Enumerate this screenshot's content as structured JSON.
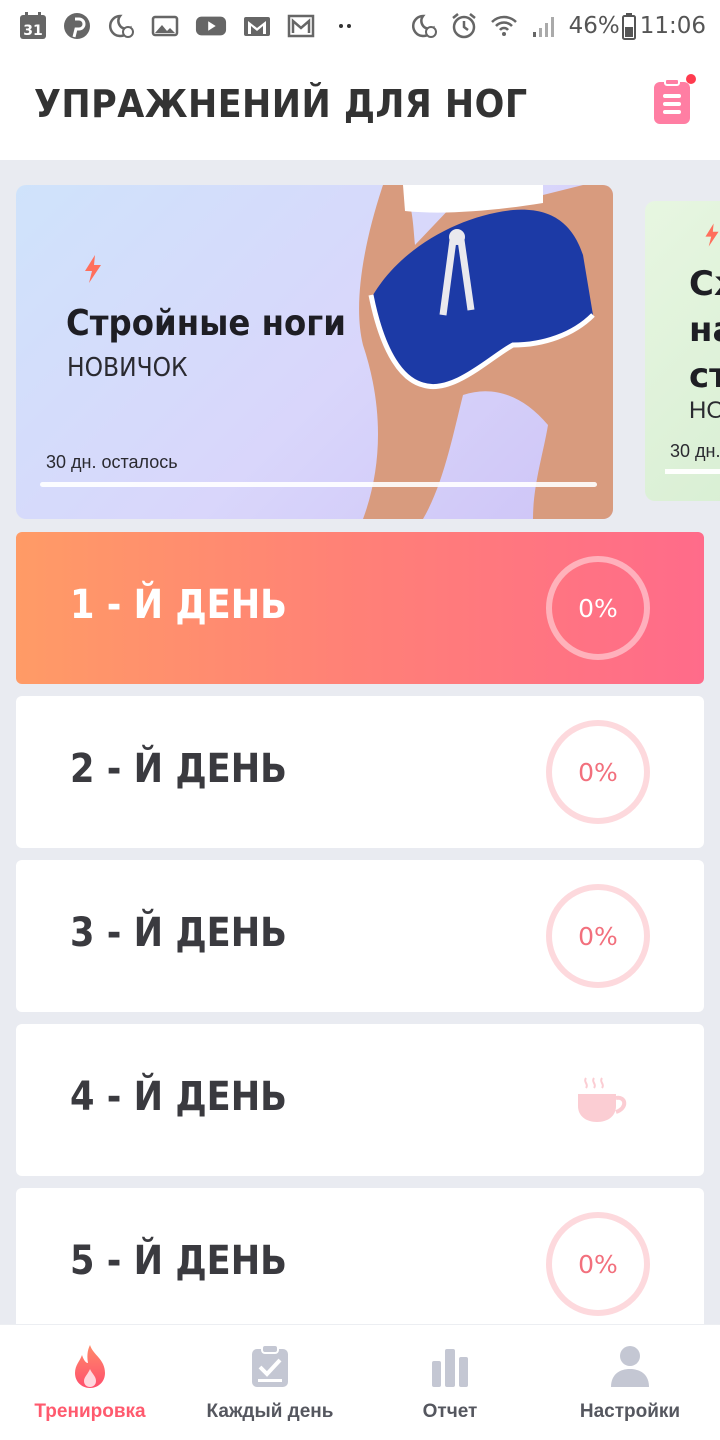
{
  "status_bar": {
    "calendar_day": "31",
    "battery": "46%",
    "time": "11:06",
    "icons": [
      "calendar-icon",
      "pinterest-icon",
      "moon-alarm-icon",
      "image-icon",
      "youtube-icon",
      "gmail-icon",
      "gmail-outline-icon",
      "dots-icon",
      "moon-alarm-icon",
      "alarm-icon",
      "wifi-icon",
      "signal-icon",
      "battery-icon"
    ]
  },
  "header": {
    "title": "УПРАЖНЕНИЙ ДЛЯ НОГ",
    "notes_icon": "clipboard-icon",
    "has_notification_dot": true
  },
  "plans": [
    {
      "name": "Стройные ноги",
      "level": "НОВИЧОК",
      "remaining": "30 дн. осталось",
      "progress": 0,
      "icon": "lightning-icon",
      "accent": "#ff6f5c"
    },
    {
      "name_lines": [
        "Сж",
        "на",
        "ст"
      ],
      "level": "НО",
      "remaining": "30 дн.",
      "icon": "lightning-icon"
    }
  ],
  "days": [
    {
      "label": "1 - Й ДЕНЬ",
      "progress": "0%",
      "active": true,
      "rest": false
    },
    {
      "label": "2 - Й ДЕНЬ",
      "progress": "0%",
      "active": false,
      "rest": false
    },
    {
      "label": "3 - Й ДЕНЬ",
      "progress": "0%",
      "active": false,
      "rest": false
    },
    {
      "label": "4 - Й ДЕНЬ",
      "progress": "",
      "active": false,
      "rest": true,
      "rest_icon": "coffee-cup-icon"
    },
    {
      "label": "5 - Й ДЕНЬ",
      "progress": "0%",
      "active": false,
      "rest": false
    }
  ],
  "bottom_nav": [
    {
      "label": "Тренировка",
      "icon": "flame-icon",
      "active": true
    },
    {
      "label": "Каждый день",
      "icon": "checklist-icon",
      "active": false
    },
    {
      "label": "Отчет",
      "icon": "bar-chart-icon",
      "active": false
    },
    {
      "label": "Настройки",
      "icon": "person-icon",
      "active": false
    }
  ],
  "colors": {
    "accent": "#ff5a6e",
    "active_gradient_start": "#ff9b66",
    "active_gradient_end": "#ff6b8a",
    "ring": "#fdd9dd",
    "background": "#e9ebf1"
  }
}
